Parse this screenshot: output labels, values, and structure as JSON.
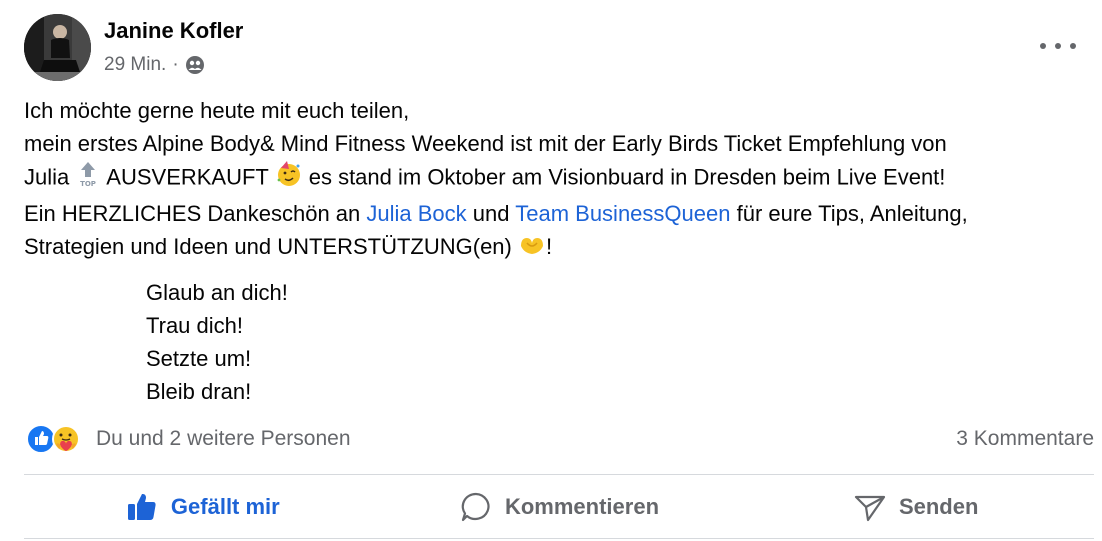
{
  "post": {
    "author": "Janine Kofler",
    "time": "29 Min.",
    "separator": "·",
    "audience_icon": "friends-icon",
    "body": {
      "line1": "Ich möchte gerne heute mit euch teilen,",
      "line2": "mein erstes Alpine Body& Mind Fitness Weekend ist mit der Early Birds Ticket Empfehlung von",
      "line3_a": "Julia",
      "line3_emoji": "top-arrow-emoji",
      "line3_b": "AUSVERKAUFT",
      "line3_emoji2": "partying-face-emoji",
      "line3_c": "es stand im Oktober am Visionbuard in Dresden beim Live Event!",
      "line4_a": "Ein HERZLICHES Dankeschön an",
      "line4_link1": "Julia Bock",
      "line4_b": "und",
      "line4_link2": "Team BusinessQueen",
      "line4_c": "für eure Tips, Anleitung,",
      "line5_a": "Strategien und Ideen und UNTERSTÜTZUNG(en)",
      "line5_emoji": "heart-hands-emoji",
      "line5_b": "!"
    },
    "motto": [
      "Glaub an dich!",
      "Trau dich!",
      "Setzte um!",
      "Bleib dran!"
    ]
  },
  "reactions": {
    "icons": [
      "like-icon",
      "care-icon"
    ],
    "text": "Du und 2 weitere Personen",
    "comments": "3 Kommentare"
  },
  "actions": {
    "like": "Gefällt mir",
    "comment": "Kommentieren",
    "send": "Senden"
  },
  "colors": {
    "link": "#1d63d6",
    "like_active": "#1d63d6",
    "secondary_text": "#65676b",
    "divider": "#d6d9dd"
  }
}
